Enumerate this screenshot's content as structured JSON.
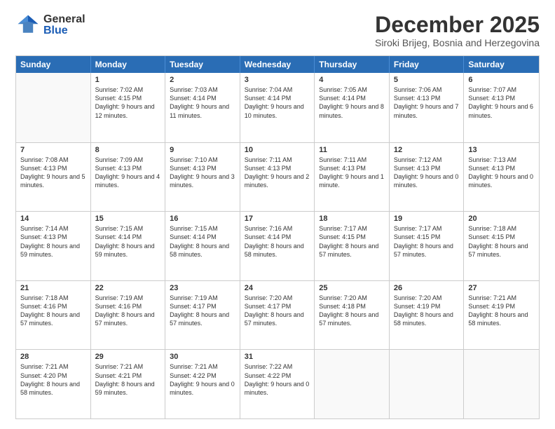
{
  "header": {
    "logo": {
      "general": "General",
      "blue": "Blue"
    },
    "title": "December 2025",
    "subtitle": "Siroki Brijeg, Bosnia and Herzegovina"
  },
  "calendar": {
    "days": [
      "Sunday",
      "Monday",
      "Tuesday",
      "Wednesday",
      "Thursday",
      "Friday",
      "Saturday"
    ],
    "weeks": [
      [
        {
          "day": "",
          "sunrise": "",
          "sunset": "",
          "daylight": ""
        },
        {
          "day": "1",
          "sunrise": "Sunrise: 7:02 AM",
          "sunset": "Sunset: 4:15 PM",
          "daylight": "Daylight: 9 hours and 12 minutes."
        },
        {
          "day": "2",
          "sunrise": "Sunrise: 7:03 AM",
          "sunset": "Sunset: 4:14 PM",
          "daylight": "Daylight: 9 hours and 11 minutes."
        },
        {
          "day": "3",
          "sunrise": "Sunrise: 7:04 AM",
          "sunset": "Sunset: 4:14 PM",
          "daylight": "Daylight: 9 hours and 10 minutes."
        },
        {
          "day": "4",
          "sunrise": "Sunrise: 7:05 AM",
          "sunset": "Sunset: 4:14 PM",
          "daylight": "Daylight: 9 hours and 8 minutes."
        },
        {
          "day": "5",
          "sunrise": "Sunrise: 7:06 AM",
          "sunset": "Sunset: 4:13 PM",
          "daylight": "Daylight: 9 hours and 7 minutes."
        },
        {
          "day": "6",
          "sunrise": "Sunrise: 7:07 AM",
          "sunset": "Sunset: 4:13 PM",
          "daylight": "Daylight: 9 hours and 6 minutes."
        }
      ],
      [
        {
          "day": "7",
          "sunrise": "Sunrise: 7:08 AM",
          "sunset": "Sunset: 4:13 PM",
          "daylight": "Daylight: 9 hours and 5 minutes."
        },
        {
          "day": "8",
          "sunrise": "Sunrise: 7:09 AM",
          "sunset": "Sunset: 4:13 PM",
          "daylight": "Daylight: 9 hours and 4 minutes."
        },
        {
          "day": "9",
          "sunrise": "Sunrise: 7:10 AM",
          "sunset": "Sunset: 4:13 PM",
          "daylight": "Daylight: 9 hours and 3 minutes."
        },
        {
          "day": "10",
          "sunrise": "Sunrise: 7:11 AM",
          "sunset": "Sunset: 4:13 PM",
          "daylight": "Daylight: 9 hours and 2 minutes."
        },
        {
          "day": "11",
          "sunrise": "Sunrise: 7:11 AM",
          "sunset": "Sunset: 4:13 PM",
          "daylight": "Daylight: 9 hours and 1 minute."
        },
        {
          "day": "12",
          "sunrise": "Sunrise: 7:12 AM",
          "sunset": "Sunset: 4:13 PM",
          "daylight": "Daylight: 9 hours and 0 minutes."
        },
        {
          "day": "13",
          "sunrise": "Sunrise: 7:13 AM",
          "sunset": "Sunset: 4:13 PM",
          "daylight": "Daylight: 9 hours and 0 minutes."
        }
      ],
      [
        {
          "day": "14",
          "sunrise": "Sunrise: 7:14 AM",
          "sunset": "Sunset: 4:13 PM",
          "daylight": "Daylight: 8 hours and 59 minutes."
        },
        {
          "day": "15",
          "sunrise": "Sunrise: 7:15 AM",
          "sunset": "Sunset: 4:14 PM",
          "daylight": "Daylight: 8 hours and 59 minutes."
        },
        {
          "day": "16",
          "sunrise": "Sunrise: 7:15 AM",
          "sunset": "Sunset: 4:14 PM",
          "daylight": "Daylight: 8 hours and 58 minutes."
        },
        {
          "day": "17",
          "sunrise": "Sunrise: 7:16 AM",
          "sunset": "Sunset: 4:14 PM",
          "daylight": "Daylight: 8 hours and 58 minutes."
        },
        {
          "day": "18",
          "sunrise": "Sunrise: 7:17 AM",
          "sunset": "Sunset: 4:15 PM",
          "daylight": "Daylight: 8 hours and 57 minutes."
        },
        {
          "day": "19",
          "sunrise": "Sunrise: 7:17 AM",
          "sunset": "Sunset: 4:15 PM",
          "daylight": "Daylight: 8 hours and 57 minutes."
        },
        {
          "day": "20",
          "sunrise": "Sunrise: 7:18 AM",
          "sunset": "Sunset: 4:15 PM",
          "daylight": "Daylight: 8 hours and 57 minutes."
        }
      ],
      [
        {
          "day": "21",
          "sunrise": "Sunrise: 7:18 AM",
          "sunset": "Sunset: 4:16 PM",
          "daylight": "Daylight: 8 hours and 57 minutes."
        },
        {
          "day": "22",
          "sunrise": "Sunrise: 7:19 AM",
          "sunset": "Sunset: 4:16 PM",
          "daylight": "Daylight: 8 hours and 57 minutes."
        },
        {
          "day": "23",
          "sunrise": "Sunrise: 7:19 AM",
          "sunset": "Sunset: 4:17 PM",
          "daylight": "Daylight: 8 hours and 57 minutes."
        },
        {
          "day": "24",
          "sunrise": "Sunrise: 7:20 AM",
          "sunset": "Sunset: 4:17 PM",
          "daylight": "Daylight: 8 hours and 57 minutes."
        },
        {
          "day": "25",
          "sunrise": "Sunrise: 7:20 AM",
          "sunset": "Sunset: 4:18 PM",
          "daylight": "Daylight: 8 hours and 57 minutes."
        },
        {
          "day": "26",
          "sunrise": "Sunrise: 7:20 AM",
          "sunset": "Sunset: 4:19 PM",
          "daylight": "Daylight: 8 hours and 58 minutes."
        },
        {
          "day": "27",
          "sunrise": "Sunrise: 7:21 AM",
          "sunset": "Sunset: 4:19 PM",
          "daylight": "Daylight: 8 hours and 58 minutes."
        }
      ],
      [
        {
          "day": "28",
          "sunrise": "Sunrise: 7:21 AM",
          "sunset": "Sunset: 4:20 PM",
          "daylight": "Daylight: 8 hours and 58 minutes."
        },
        {
          "day": "29",
          "sunrise": "Sunrise: 7:21 AM",
          "sunset": "Sunset: 4:21 PM",
          "daylight": "Daylight: 8 hours and 59 minutes."
        },
        {
          "day": "30",
          "sunrise": "Sunrise: 7:21 AM",
          "sunset": "Sunset: 4:22 PM",
          "daylight": "Daylight: 9 hours and 0 minutes."
        },
        {
          "day": "31",
          "sunrise": "Sunrise: 7:22 AM",
          "sunset": "Sunset: 4:22 PM",
          "daylight": "Daylight: 9 hours and 0 minutes."
        },
        {
          "day": "",
          "sunrise": "",
          "sunset": "",
          "daylight": ""
        },
        {
          "day": "",
          "sunrise": "",
          "sunset": "",
          "daylight": ""
        },
        {
          "day": "",
          "sunrise": "",
          "sunset": "",
          "daylight": ""
        }
      ]
    ]
  }
}
